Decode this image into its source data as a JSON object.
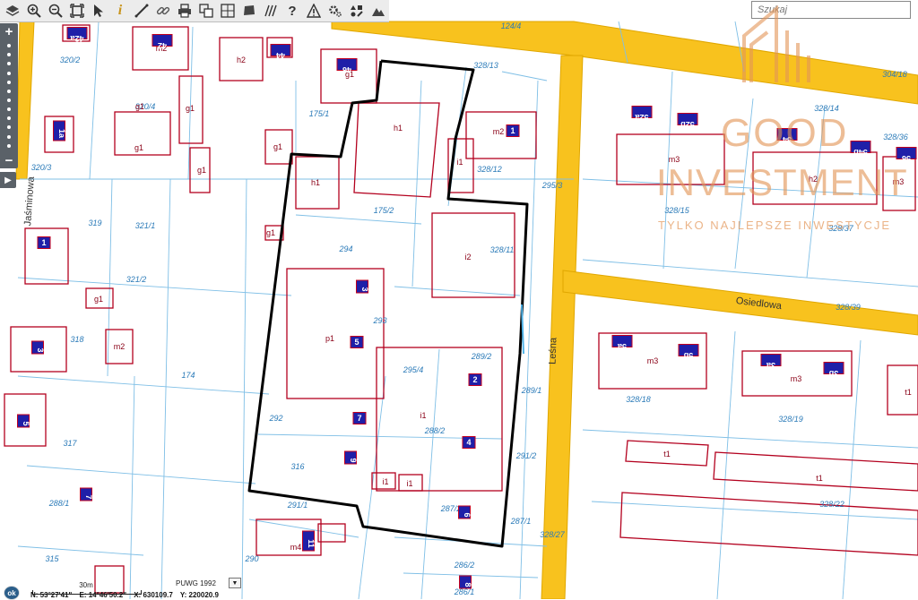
{
  "search": {
    "placeholder": "Szukaj"
  },
  "streets": [
    {
      "name": "Leśna"
    },
    {
      "name": "Osiedlowa"
    },
    {
      "name": "Jaśminowa"
    }
  ],
  "parcels": [
    "320/2",
    "320/3",
    "320/4",
    "124/4",
    "328/13",
    "175/1",
    "328/12",
    "175/2",
    "295/3",
    "319",
    "321/1",
    "321/2",
    "294",
    "328/11",
    "293",
    "318",
    "174",
    "295/4",
    "289/2",
    "289/1",
    "317",
    "292",
    "288/2",
    "291/2",
    "288/1",
    "316",
    "291/1",
    "287/2",
    "287/1",
    "328/27",
    "290",
    "315",
    "286/2",
    "286/1",
    "304/18",
    "328/14",
    "328/36",
    "328/15",
    "328/37",
    "328/39",
    "328/18",
    "328/19",
    "328/22"
  ],
  "buildings": [
    "m2",
    "h2",
    "g1",
    "g1",
    "g1",
    "g1",
    "g1",
    "g1",
    "m2",
    "h1",
    "i1",
    "h1",
    "g1",
    "i2",
    "p1",
    "i1",
    "i1",
    "i1",
    "g1",
    "m2",
    "m4",
    "m3",
    "h2",
    "m3",
    "m3",
    "m3",
    "t1",
    "t1",
    "t1"
  ],
  "numbers": [
    "42a",
    "42",
    "44",
    "46",
    "1a",
    "1",
    "1",
    "3",
    "5",
    "7",
    "9",
    "3",
    "2",
    "4",
    "6",
    "5",
    "7",
    "11",
    "8",
    "52a",
    "52b",
    "54",
    "54b",
    "56",
    "5a",
    "5b",
    "3a",
    "3b"
  ],
  "scale": {
    "label": "30m"
  },
  "projection": {
    "label": "PUWG 1992"
  },
  "coords": {
    "n": "N: 53°27'41\"",
    "e": "E: 14°46'50.2\"",
    "x": "X: 630109.7",
    "y": "Y: 220020.9"
  },
  "ok_label": "ok",
  "watermark": {
    "line1": "GOOD",
    "line2": "INVESTMENT",
    "tagline": "TYLKO NAJLEPSZE INWESTYCJE"
  },
  "colors": {
    "road": "#f8c21e",
    "parcel": "#4aa3df",
    "building": "#b3001e",
    "label_bg": "#1f1fa8",
    "selection": "#000000"
  }
}
